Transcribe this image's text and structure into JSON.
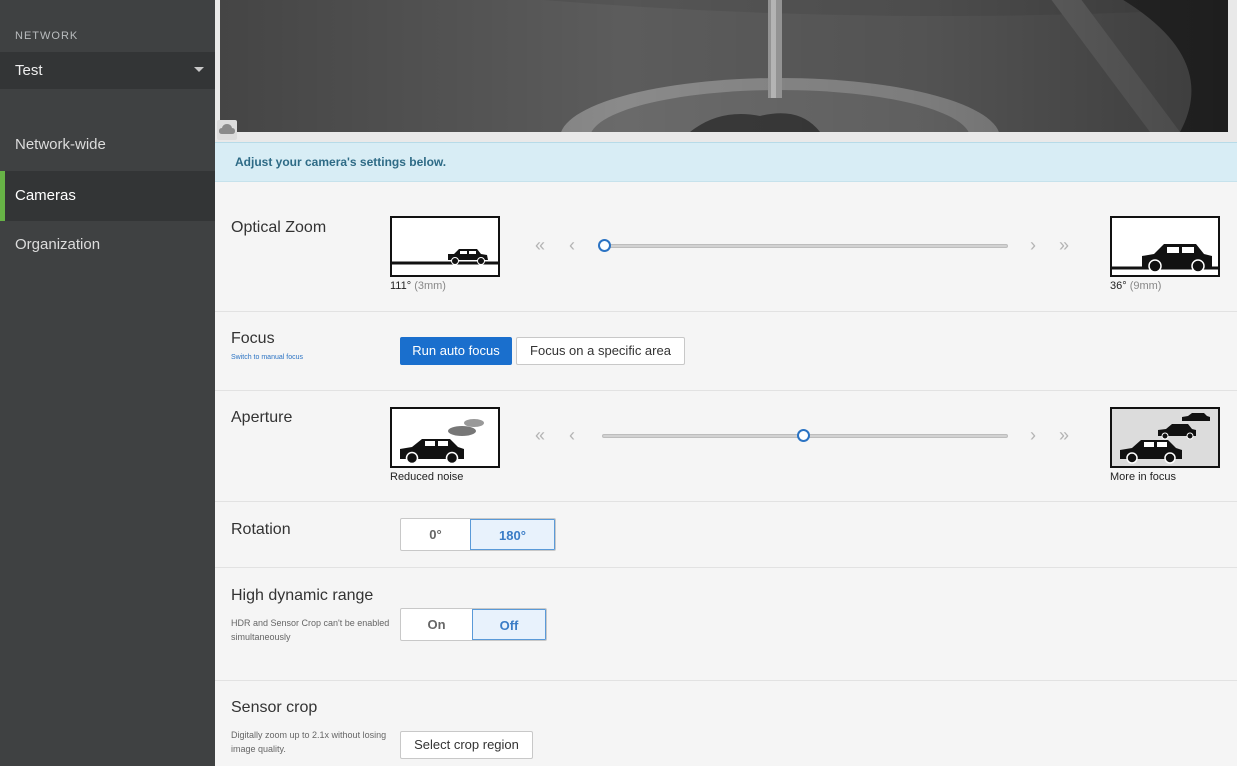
{
  "sidebar": {
    "network_label": "NETWORK",
    "network_value": "Test",
    "items": [
      {
        "label": "Network-wide"
      },
      {
        "label": "Cameras"
      },
      {
        "label": "Organization"
      }
    ]
  },
  "banner": {
    "text": "Adjust your camera's settings below."
  },
  "zoom": {
    "title": "Optical Zoom",
    "left_caption": "111°",
    "left_caption_sub": "(3mm)",
    "right_caption": "36°",
    "right_caption_sub": "(9mm)",
    "value_fraction": 0.0
  },
  "focus": {
    "title": "Focus",
    "link": "Switch to manual focus",
    "auto_btn": "Run auto focus",
    "area_btn": "Focus on a specific area"
  },
  "aperture": {
    "title": "Aperture",
    "left_caption": "Reduced noise",
    "right_caption": "More in focus",
    "value_fraction": 0.49
  },
  "rotation": {
    "title": "Rotation",
    "options": [
      "0°",
      "180°"
    ],
    "selected": "180°"
  },
  "hdr": {
    "title": "High dynamic range",
    "sub": "HDR and Sensor Crop can't be enabled simultaneously",
    "options": [
      "On",
      "Off"
    ],
    "selected": "Off"
  },
  "crop": {
    "title": "Sensor crop",
    "sub": "Digitally zoom up to 2.1x without losing image quality.",
    "btn": "Select crop region"
  },
  "colors": {
    "accent": "#1a6fcd",
    "active_nav": "#67b346"
  }
}
